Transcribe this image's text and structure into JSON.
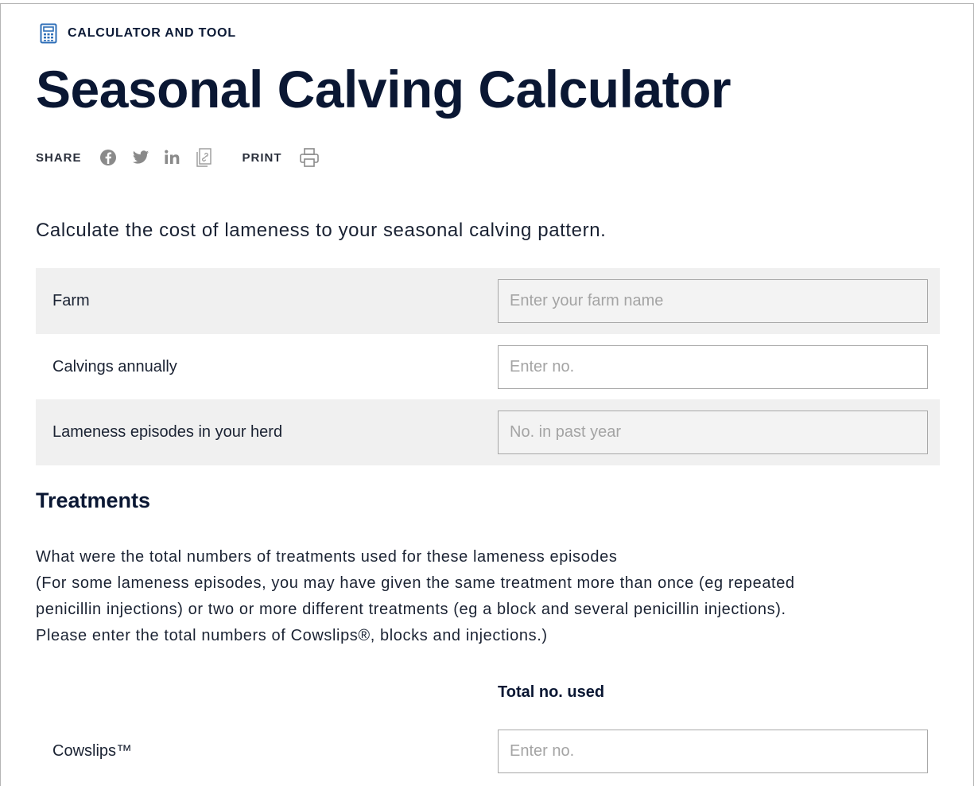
{
  "header": {
    "eyebrow": "CALCULATOR AND TOOL",
    "eyebrow_icon": "calculator-icon",
    "title": "Seasonal Calving Calculator"
  },
  "share": {
    "label": "SHARE",
    "icons": [
      "facebook-icon",
      "twitter-icon",
      "linkedin-icon",
      "copy-link-icon"
    ],
    "print_label": "PRINT",
    "print_icon": "printer-icon"
  },
  "intro": "Calculate the cost of lameness to your seasonal calving pattern.",
  "fields": [
    {
      "label": "Farm",
      "placeholder": "Enter your farm name",
      "value": ""
    },
    {
      "label": "Calvings annually",
      "placeholder": "Enter no.",
      "value": ""
    },
    {
      "label": "Lameness episodes in your herd",
      "placeholder": "No. in past year",
      "value": ""
    }
  ],
  "treatments": {
    "heading": "Treatments",
    "description": [
      "What were the total numbers of treatments used for these lameness episodes",
      "(For some lameness episodes, you may have given the same treatment more than once (eg repeated",
      "penicillin injections) or two or more different treatments (eg a block and several penicillin injections).",
      "Please enter the total numbers of Cowslips®, blocks and injections.)"
    ],
    "column_header": "Total no. used",
    "items": [
      {
        "label": "Cowslips™",
        "placeholder": "Enter no.",
        "value": ""
      }
    ]
  },
  "colors": {
    "heading": "#0a1733",
    "accent_blue": "#2f6fb8",
    "row_shade": "#f0f0f0",
    "field_border": "#a8a8a8",
    "placeholder": "#a4a4a4",
    "icon_gray": "#8a8a8a"
  }
}
